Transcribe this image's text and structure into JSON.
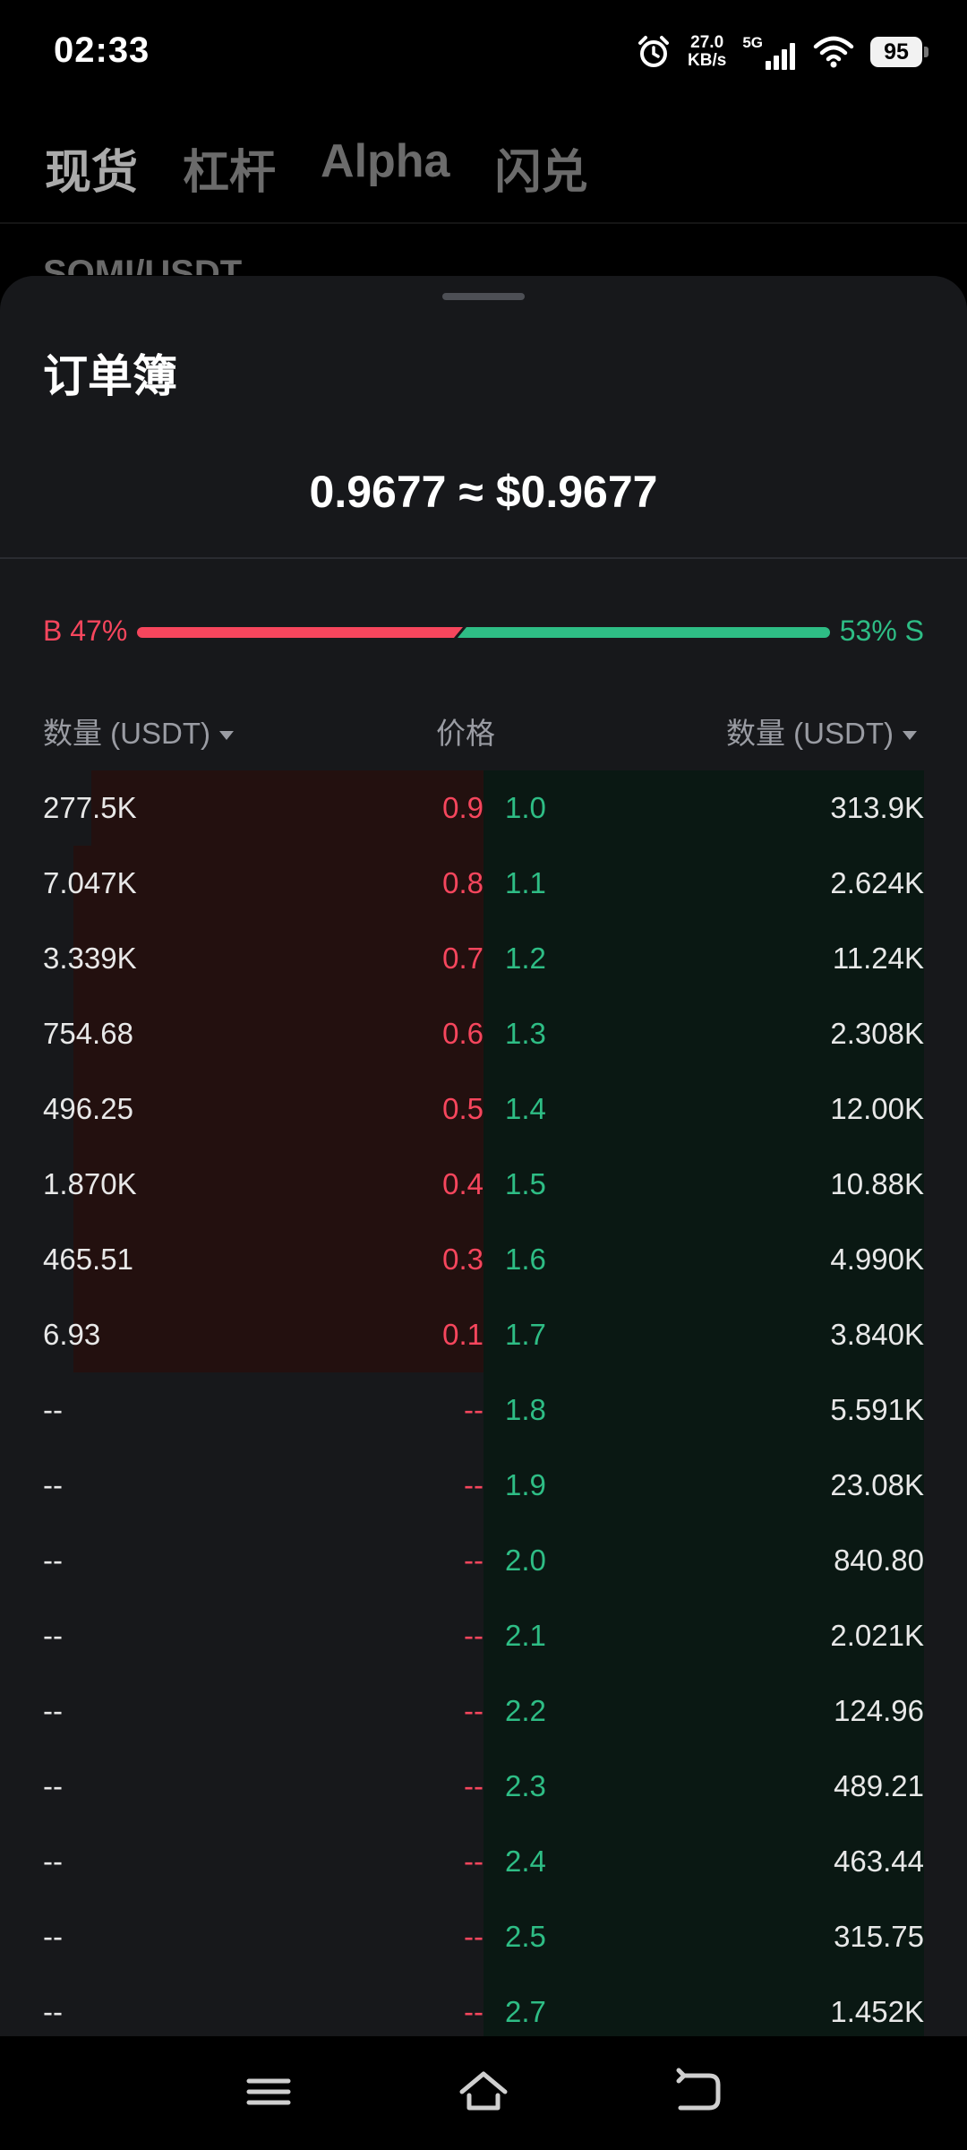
{
  "status_bar": {
    "time": "02:33",
    "speed_value": "27.0",
    "speed_unit": "KB/s",
    "network": "5G",
    "battery": "95"
  },
  "background": {
    "tabs": [
      {
        "label": "现货",
        "active": true
      },
      {
        "label": "杠杆",
        "active": false
      },
      {
        "label": "Alpha",
        "active": false
      },
      {
        "label": "闪兑",
        "active": false
      }
    ],
    "pair": "SOMI/USDT"
  },
  "sheet": {
    "title": "订单簿",
    "mid_price": "0.9677 ≈ $0.9677",
    "buy_label": "B 47%",
    "sell_label": "53% S",
    "buy_ratio": 0.47,
    "sell_ratio": 0.53,
    "headers": {
      "bid_qty": "数量 (USDT)",
      "price": "价格",
      "ask_qty": "数量 (USDT)"
    },
    "rows": [
      {
        "bid_qty": "277.5K",
        "bid_price": "0.9",
        "ask_price": "1.0",
        "ask_qty": "313.9K",
        "bid_depth": 0.89,
        "ask_depth": 1.0
      },
      {
        "bid_qty": "7.047K",
        "bid_price": "0.8",
        "ask_price": "1.1",
        "ask_qty": "2.624K",
        "bid_depth": 0.93,
        "ask_depth": 1.0
      },
      {
        "bid_qty": "3.339K",
        "bid_price": "0.7",
        "ask_price": "1.2",
        "ask_qty": "11.24K",
        "bid_depth": 0.93,
        "ask_depth": 1.0
      },
      {
        "bid_qty": "754.68",
        "bid_price": "0.6",
        "ask_price": "1.3",
        "ask_qty": "2.308K",
        "bid_depth": 0.93,
        "ask_depth": 1.0
      },
      {
        "bid_qty": "496.25",
        "bid_price": "0.5",
        "ask_price": "1.4",
        "ask_qty": "12.00K",
        "bid_depth": 0.93,
        "ask_depth": 1.0
      },
      {
        "bid_qty": "1.870K",
        "bid_price": "0.4",
        "ask_price": "1.5",
        "ask_qty": "10.88K",
        "bid_depth": 0.93,
        "ask_depth": 1.0
      },
      {
        "bid_qty": "465.51",
        "bid_price": "0.3",
        "ask_price": "1.6",
        "ask_qty": "4.990K",
        "bid_depth": 0.93,
        "ask_depth": 1.0
      },
      {
        "bid_qty": "6.93",
        "bid_price": "0.1",
        "ask_price": "1.7",
        "ask_qty": "3.840K",
        "bid_depth": 0.93,
        "ask_depth": 1.0
      },
      {
        "bid_qty": "--",
        "bid_price": "--",
        "ask_price": "1.8",
        "ask_qty": "5.591K",
        "bid_depth": 0,
        "ask_depth": 1.0
      },
      {
        "bid_qty": "--",
        "bid_price": "--",
        "ask_price": "1.9",
        "ask_qty": "23.08K",
        "bid_depth": 0,
        "ask_depth": 1.0
      },
      {
        "bid_qty": "--",
        "bid_price": "--",
        "ask_price": "2.0",
        "ask_qty": "840.80",
        "bid_depth": 0,
        "ask_depth": 1.0
      },
      {
        "bid_qty": "--",
        "bid_price": "--",
        "ask_price": "2.1",
        "ask_qty": "2.021K",
        "bid_depth": 0,
        "ask_depth": 1.0
      },
      {
        "bid_qty": "--",
        "bid_price": "--",
        "ask_price": "2.2",
        "ask_qty": "124.96",
        "bid_depth": 0,
        "ask_depth": 1.0
      },
      {
        "bid_qty": "--",
        "bid_price": "--",
        "ask_price": "2.3",
        "ask_qty": "489.21",
        "bid_depth": 0,
        "ask_depth": 1.0
      },
      {
        "bid_qty": "--",
        "bid_price": "--",
        "ask_price": "2.4",
        "ask_qty": "463.44",
        "bid_depth": 0,
        "ask_depth": 1.0
      },
      {
        "bid_qty": "--",
        "bid_price": "--",
        "ask_price": "2.5",
        "ask_qty": "315.75",
        "bid_depth": 0,
        "ask_depth": 1.0
      },
      {
        "bid_qty": "--",
        "bid_price": "--",
        "ask_price": "2.7",
        "ask_qty": "1.452K",
        "bid_depth": 0,
        "ask_depth": 1.0
      }
    ]
  },
  "nav_icons": [
    "menu-icon",
    "home-icon",
    "back-icon"
  ],
  "colors": {
    "buy": "#f6465d",
    "sell": "#2ebd85",
    "sheet_bg": "#17181b"
  }
}
